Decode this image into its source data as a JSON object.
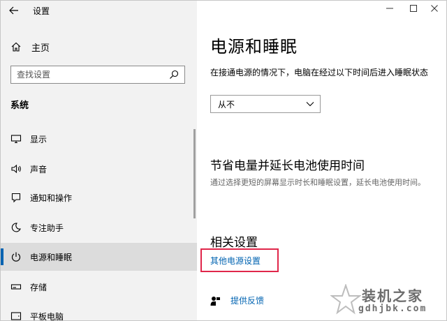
{
  "window": {
    "title": "设置"
  },
  "sidebar": {
    "home_label": "主页",
    "search_placeholder": "查找设置",
    "section_label": "系统",
    "items": [
      {
        "label": "显示",
        "icon": "monitor-icon",
        "active": false
      },
      {
        "label": "声音",
        "icon": "speaker-icon",
        "active": false
      },
      {
        "label": "通知和操作",
        "icon": "notification-icon",
        "active": false
      },
      {
        "label": "专注助手",
        "icon": "moon-icon",
        "active": false
      },
      {
        "label": "电源和睡眠",
        "icon": "power-icon",
        "active": true
      },
      {
        "label": "存储",
        "icon": "storage-icon",
        "active": false
      },
      {
        "label": "平板电脑",
        "icon": "tablet-icon",
        "active": false
      }
    ]
  },
  "main": {
    "title": "电源和睡眠",
    "sleep_description": "在接通电源的情况下，电脑在经过以下时间后进入睡眠状态",
    "sleep_dropdown_value": "从不",
    "battery_heading": "节省电量并延长电池使用时间",
    "battery_description": "通过选择更短的屏幕显示时长和睡眠设置，延长电池使用时间。",
    "related_heading": "相关设置",
    "related_link": "其他电源设置",
    "feedback_label": "提供反馈"
  },
  "watermark": {
    "title": "装机之家",
    "url": "gdhjbk.com"
  },
  "colors": {
    "accent": "#0063b1",
    "highlight_box": "#e0264a",
    "sidebar_bg": "#f2f2f2"
  }
}
